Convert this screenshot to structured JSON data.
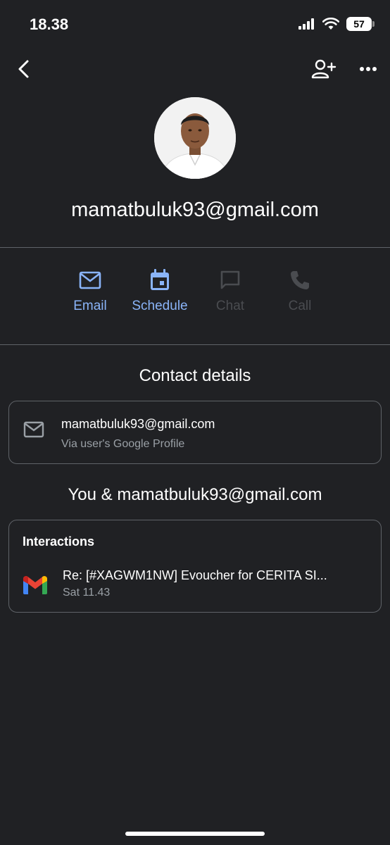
{
  "status_bar": {
    "time": "18.38",
    "battery": "57"
  },
  "contact": {
    "name": "mamatbuluk93@gmail.com"
  },
  "actions": [
    {
      "label": "Email",
      "icon": "mail-icon",
      "enabled": true
    },
    {
      "label": "Schedule",
      "icon": "calendar-icon",
      "enabled": true
    },
    {
      "label": "Chat",
      "icon": "chat-icon",
      "enabled": false
    },
    {
      "label": "Call",
      "icon": "phone-icon",
      "enabled": false
    }
  ],
  "contact_details": {
    "title": "Contact details",
    "email": "mamatbuluk93@gmail.com",
    "source": "Via user's Google Profile"
  },
  "relationship": {
    "title": "You & mamatbuluk93@gmail.com",
    "heading": "Interactions",
    "items": [
      {
        "subject": "Re: [#XAGWM1NW] Evoucher for CERITA SI...",
        "date": "Sat 11.43",
        "icon": "gmail-icon"
      }
    ]
  },
  "colors": {
    "background": "#202124",
    "accent": "#8ab4f8",
    "disabled": "#4a4c50",
    "divider": "#5f6368"
  }
}
